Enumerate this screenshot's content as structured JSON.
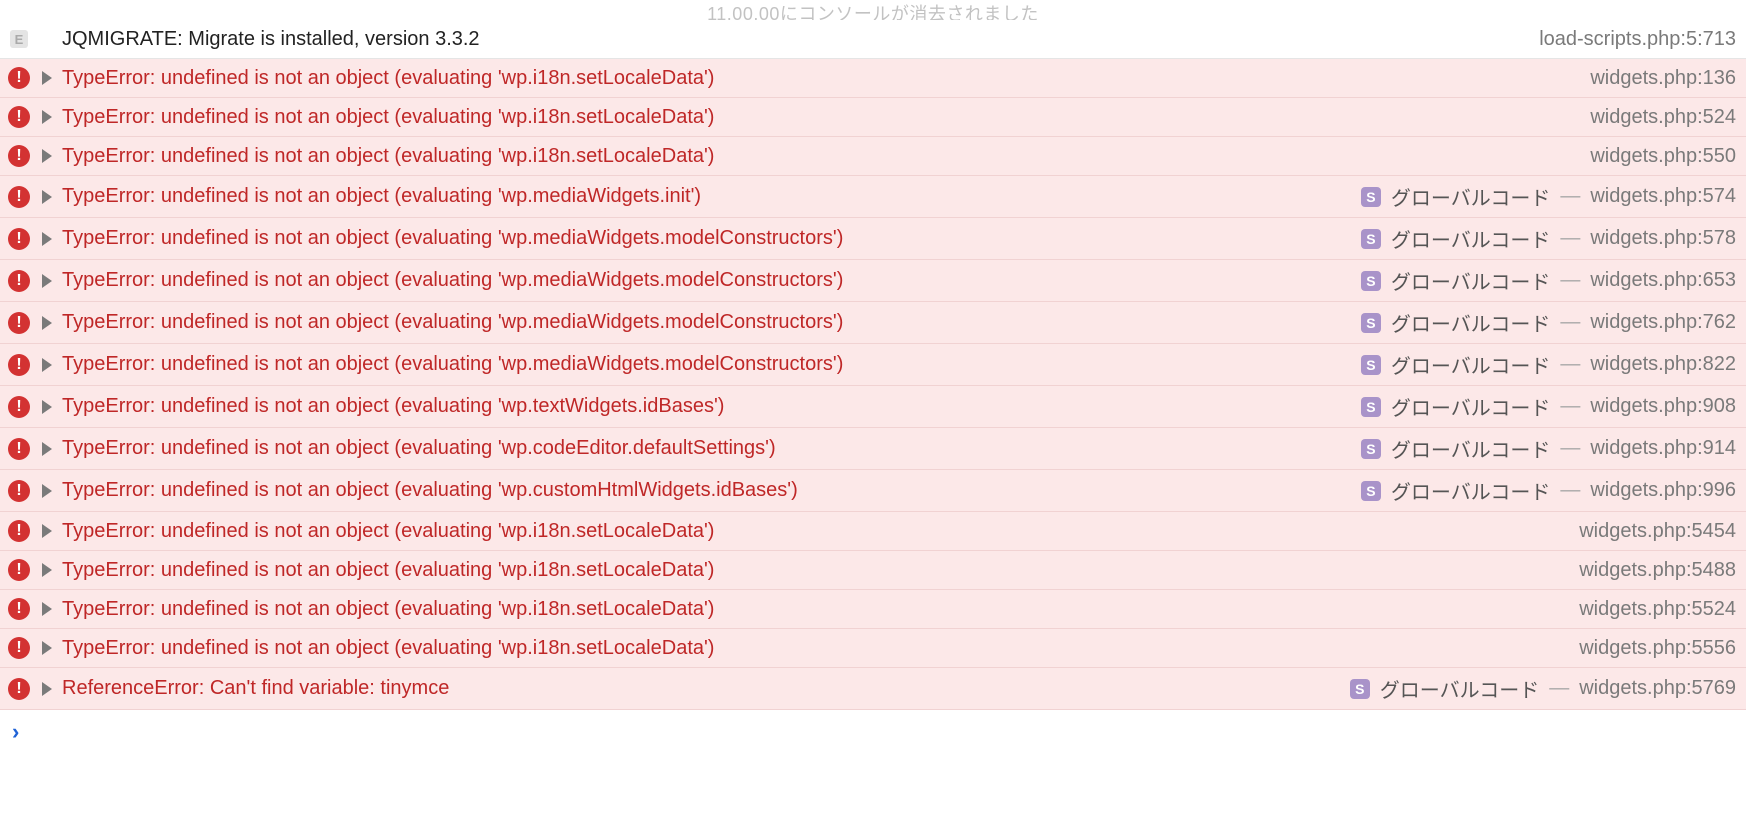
{
  "ghost_header": "11.00.00にコンソールが消去されました",
  "badges": {
    "log_glyph": "E",
    "error_glyph": "!",
    "script_glyph": "S"
  },
  "scope_label": "グローバルコード",
  "dash": "—",
  "entries": [
    {
      "type": "log",
      "has_disclosure": false,
      "message": "JQMIGRATE: Migrate is installed, version 3.3.2",
      "has_scope": false,
      "source": "load-scripts.php:5:713"
    },
    {
      "type": "error",
      "has_disclosure": true,
      "message": "TypeError: undefined is not an object (evaluating 'wp.i18n.setLocaleData')",
      "has_scope": false,
      "source": "widgets.php:136"
    },
    {
      "type": "error",
      "has_disclosure": true,
      "message": "TypeError: undefined is not an object (evaluating 'wp.i18n.setLocaleData')",
      "has_scope": false,
      "source": "widgets.php:524"
    },
    {
      "type": "error",
      "has_disclosure": true,
      "message": "TypeError: undefined is not an object (evaluating 'wp.i18n.setLocaleData')",
      "has_scope": false,
      "source": "widgets.php:550"
    },
    {
      "type": "error",
      "has_disclosure": true,
      "message": "TypeError: undefined is not an object (evaluating 'wp.mediaWidgets.init')",
      "has_scope": true,
      "source": "widgets.php:574"
    },
    {
      "type": "error",
      "has_disclosure": true,
      "message": "TypeError: undefined is not an object (evaluating 'wp.mediaWidgets.modelConstructors')",
      "has_scope": true,
      "source": "widgets.php:578"
    },
    {
      "type": "error",
      "has_disclosure": true,
      "message": "TypeError: undefined is not an object (evaluating 'wp.mediaWidgets.modelConstructors')",
      "has_scope": true,
      "source": "widgets.php:653"
    },
    {
      "type": "error",
      "has_disclosure": true,
      "message": "TypeError: undefined is not an object (evaluating 'wp.mediaWidgets.modelConstructors')",
      "has_scope": true,
      "source": "widgets.php:762"
    },
    {
      "type": "error",
      "has_disclosure": true,
      "message": "TypeError: undefined is not an object (evaluating 'wp.mediaWidgets.modelConstructors')",
      "has_scope": true,
      "source": "widgets.php:822"
    },
    {
      "type": "error",
      "has_disclosure": true,
      "message": "TypeError: undefined is not an object (evaluating 'wp.textWidgets.idBases')",
      "has_scope": true,
      "source": "widgets.php:908"
    },
    {
      "type": "error",
      "has_disclosure": true,
      "message": "TypeError: undefined is not an object (evaluating 'wp.codeEditor.defaultSettings')",
      "has_scope": true,
      "source": "widgets.php:914"
    },
    {
      "type": "error",
      "has_disclosure": true,
      "message": "TypeError: undefined is not an object (evaluating 'wp.customHtmlWidgets.idBases')",
      "has_scope": true,
      "source": "widgets.php:996"
    },
    {
      "type": "error",
      "has_disclosure": true,
      "message": "TypeError: undefined is not an object (evaluating 'wp.i18n.setLocaleData')",
      "has_scope": false,
      "source": "widgets.php:5454"
    },
    {
      "type": "error",
      "has_disclosure": true,
      "message": "TypeError: undefined is not an object (evaluating 'wp.i18n.setLocaleData')",
      "has_scope": false,
      "source": "widgets.php:5488"
    },
    {
      "type": "error",
      "has_disclosure": true,
      "message": "TypeError: undefined is not an object (evaluating 'wp.i18n.setLocaleData')",
      "has_scope": false,
      "source": "widgets.php:5524"
    },
    {
      "type": "error",
      "has_disclosure": true,
      "message": "TypeError: undefined is not an object (evaluating 'wp.i18n.setLocaleData')",
      "has_scope": false,
      "source": "widgets.php:5556"
    },
    {
      "type": "error",
      "has_disclosure": true,
      "message": "ReferenceError: Can't find variable: tinymce",
      "has_scope": true,
      "source": "widgets.php:5769"
    }
  ],
  "prompt": "›"
}
